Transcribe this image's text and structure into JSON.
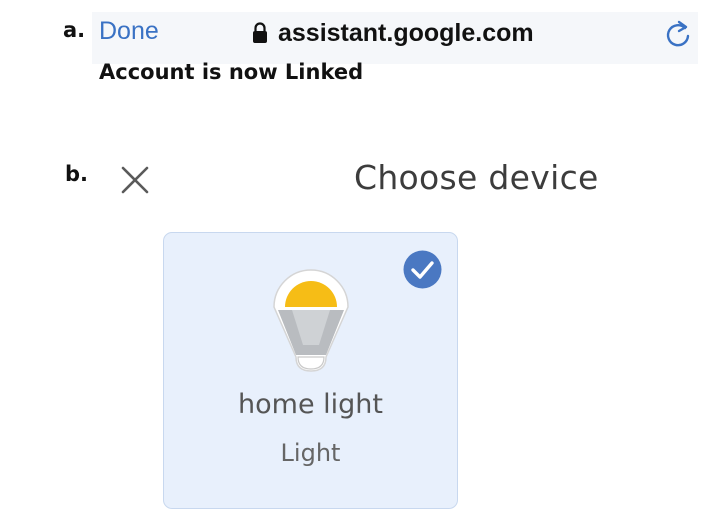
{
  "labels": {
    "a": "a.",
    "b": "b."
  },
  "browser": {
    "done_label": "Done",
    "url": "assistant.google.com",
    "lock_icon": "lock-icon",
    "reload_icon": "reload-icon",
    "accent_color": "#3a72c4"
  },
  "status": {
    "message": "Account is now Linked"
  },
  "chooser": {
    "title": "Choose device",
    "close_icon": "close-icon",
    "devices": [
      {
        "name": "home light",
        "type": "Light",
        "selected": true,
        "icon": "light-bulb-icon"
      }
    ],
    "card_color": "#e8f0fc",
    "check_color": "#4a78c2",
    "bulb_color": "#f6bd16"
  }
}
